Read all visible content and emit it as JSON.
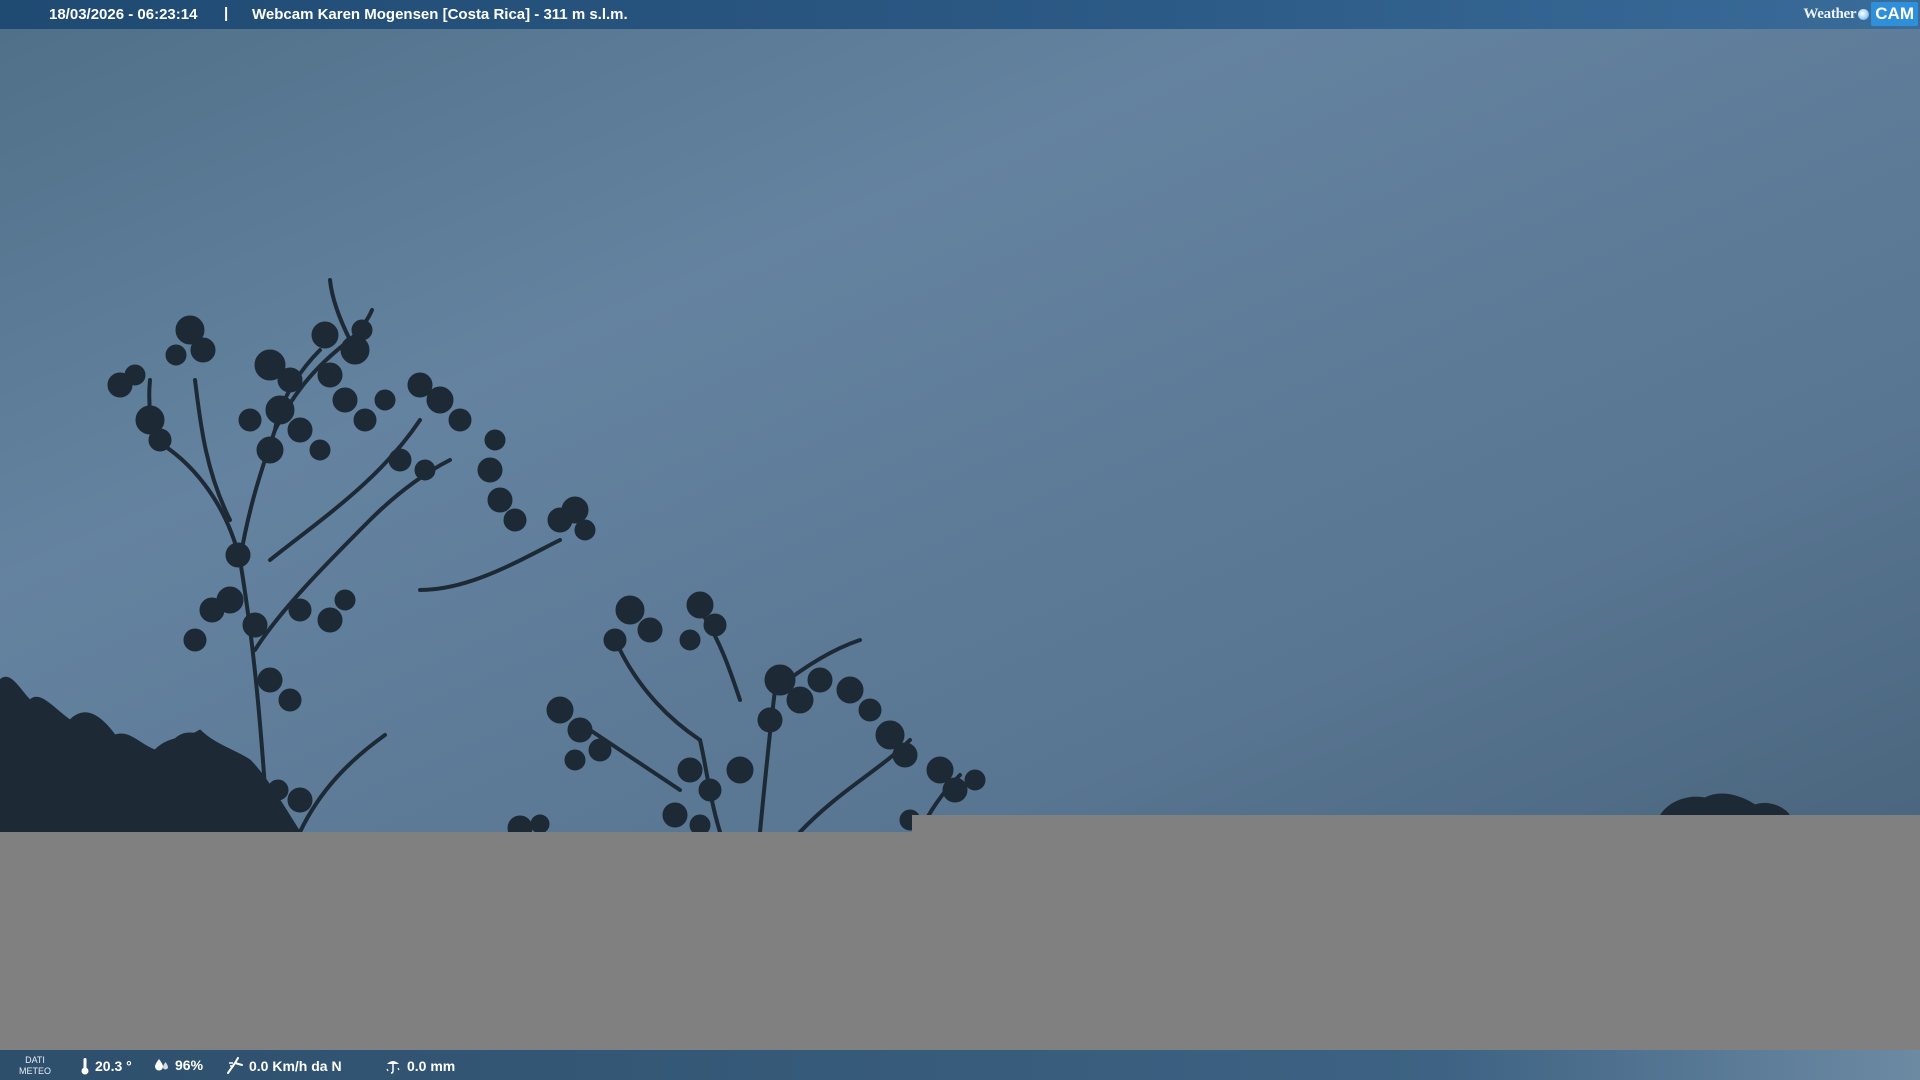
{
  "header": {
    "datetime": "18/03/2026 - 06:23:14",
    "separator": "|",
    "webcam_title": "Webcam Karen Mogensen [Costa Rica]  - 311 m s.l.m."
  },
  "logo": {
    "weather": "Weather",
    "cam": "CAM"
  },
  "footer": {
    "label_line1": "DATI",
    "label_line2": "METEO",
    "temperature": "20.3 °",
    "humidity": "96%",
    "wind": "0.0 Km/h da N",
    "rain": "0.0 mm",
    "icons": [
      "thermometer-icon",
      "humidity-icon",
      "wind-icon",
      "rain-gauge-icon"
    ]
  },
  "colors": {
    "sky_top": "#4f6f88",
    "sky_mid": "#6482a0",
    "gray_panel": "#808080",
    "bar_blue": "#2c5a86"
  }
}
